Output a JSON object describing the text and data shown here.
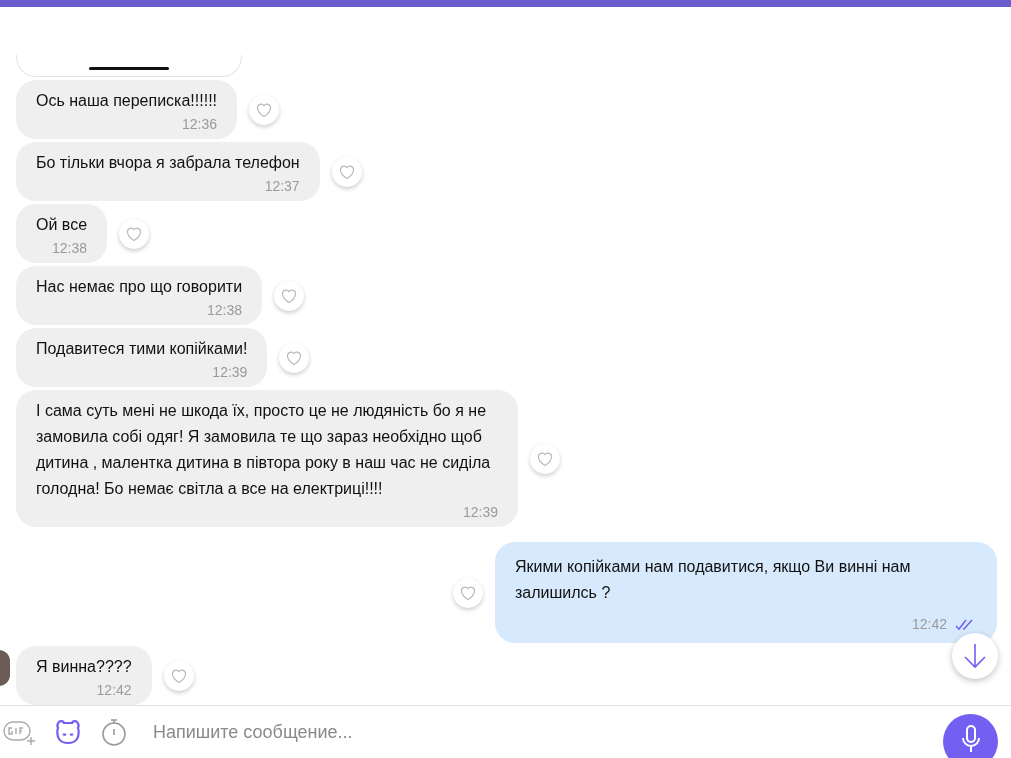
{
  "messages": [
    {
      "kind": "in",
      "text": "Ось наша переписка!!!!!!",
      "time": "12:36",
      "avatar": false
    },
    {
      "kind": "in",
      "text": "Бо тільки вчора я забрала телефон",
      "time": "12:37",
      "avatar": false
    },
    {
      "kind": "in",
      "text": "Ой все",
      "time": "12:38",
      "avatar": false
    },
    {
      "kind": "in",
      "text": "Нас немає про що говорити",
      "time": "12:38",
      "avatar": false
    },
    {
      "kind": "in",
      "text": "Подавитеся тими копійками!",
      "time": "12:39",
      "avatar": false
    },
    {
      "kind": "in",
      "text": "І сама суть мені не шкода їх, просто це не людяність бо я не замовила собі одяг! Я замовила те що зараз необхідно щоб дитина , малентка дитина в півтора року в наш час не сиділа голодна! Бо немає світла а все на електриці!!!!",
      "time": "12:39",
      "avatar": false
    },
    {
      "kind": "out",
      "text": "Якими копійками нам подавитися, якщо Ви винні нам залишилсь ?",
      "time": "12:42",
      "read": true
    },
    {
      "kind": "in",
      "text": "Я винна????",
      "time": "12:42",
      "avatar": true
    }
  ],
  "composer": {
    "placeholder": "Напишите сообщение..."
  }
}
